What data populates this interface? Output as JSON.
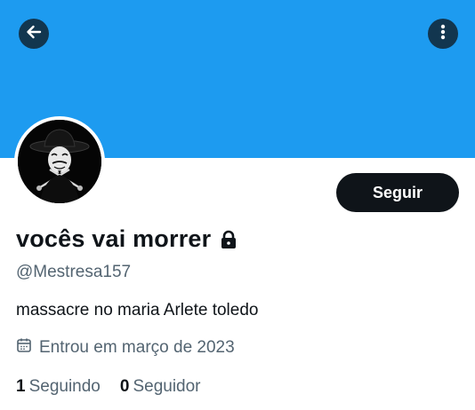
{
  "header": {
    "back_icon": "arrow-left-icon",
    "more_icon": "more-vertical-icon",
    "banner_color": "#1d9bf0"
  },
  "profile": {
    "display_name": "vocês vai morrer",
    "lock_icon": "lock-icon",
    "handle": "@Mestresa157",
    "bio": "massacre no maria Arlete toledo",
    "joined_icon": "calendar-icon",
    "joined": "Entrou em março de 2023",
    "avatar_icon": "masked-figure-avatar"
  },
  "actions": {
    "follow_label": "Seguir"
  },
  "stats": {
    "following_count": "1",
    "following_label": "Seguindo",
    "followers_count": "0",
    "followers_label": "Seguidor"
  },
  "colors": {
    "accent": "#1d9bf0",
    "text": "#0f1419",
    "secondary_text": "#536471",
    "button": "#0f1419"
  }
}
